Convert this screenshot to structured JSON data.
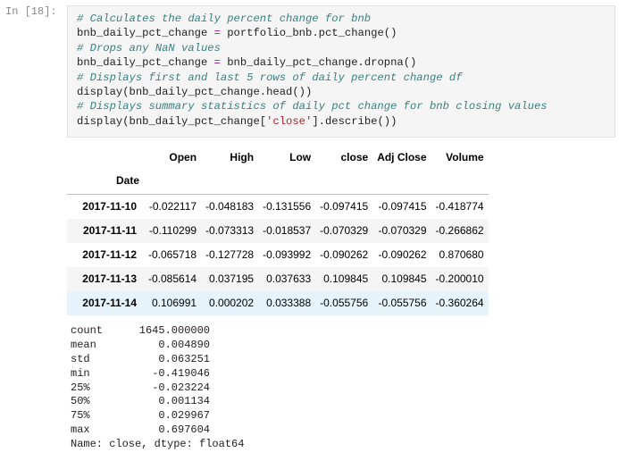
{
  "cell": {
    "prompt": "In [18]:",
    "code_lines": [
      [
        {
          "t": "# Calculates the daily percent change for bnb",
          "c": "cm"
        }
      ],
      [
        {
          "t": "bnb_daily_pct_change ",
          "c": "fn"
        },
        {
          "t": "=",
          "c": "op"
        },
        {
          "t": " portfolio_bnb.pct_change()",
          "c": "fn"
        }
      ],
      [
        {
          "t": "# Drops any NaN values",
          "c": "cm"
        }
      ],
      [
        {
          "t": "bnb_daily_pct_change ",
          "c": "fn"
        },
        {
          "t": "=",
          "c": "op"
        },
        {
          "t": " bnb_daily_pct_change.dropna()",
          "c": "fn"
        }
      ],
      [
        {
          "t": "# Displays first and last 5 rows of daily percent change df",
          "c": "cm"
        }
      ],
      [
        {
          "t": "display(bnb_daily_pct_change.head())",
          "c": "fn"
        }
      ],
      [
        {
          "t": "# Displays summary statistics of daily pct change for bnb closing values",
          "c": "cm"
        }
      ],
      [
        {
          "t": "display(bnb_daily_pct_change[",
          "c": "fn"
        },
        {
          "t": "'close'",
          "c": "str"
        },
        {
          "t": "].describe())",
          "c": "fn"
        }
      ]
    ]
  },
  "dataframe": {
    "columns": [
      "Open",
      "High",
      "Low",
      "close",
      "Adj Close",
      "Volume"
    ],
    "index_name": "Date",
    "rows": [
      {
        "index": "2017-11-10",
        "values": [
          "-0.022117",
          "-0.048183",
          "-0.131556",
          "-0.097415",
          "-0.097415",
          "-0.418774"
        ]
      },
      {
        "index": "2017-11-11",
        "values": [
          "-0.110299",
          "-0.073313",
          "-0.018537",
          "-0.070329",
          "-0.070329",
          "-0.266862"
        ]
      },
      {
        "index": "2017-11-12",
        "values": [
          "-0.065718",
          "-0.127728",
          "-0.093992",
          "-0.090262",
          "-0.090262",
          "0.870680"
        ]
      },
      {
        "index": "2017-11-13",
        "values": [
          "-0.085614",
          "0.037195",
          "0.037633",
          "0.109845",
          "0.109845",
          "-0.200010"
        ]
      },
      {
        "index": "2017-11-14",
        "values": [
          "0.106991",
          "0.000202",
          "0.033388",
          "-0.055756",
          "-0.055756",
          "-0.360264"
        ]
      }
    ],
    "hover_row_index": 4
  },
  "describe": {
    "rows": [
      {
        "label": "count",
        "value": "1645.000000"
      },
      {
        "label": "mean",
        "value": "0.004890"
      },
      {
        "label": "std",
        "value": "0.063251"
      },
      {
        "label": "min",
        "value": "-0.419046"
      },
      {
        "label": "25%",
        "value": "-0.023224"
      },
      {
        "label": "50%",
        "value": "0.001134"
      },
      {
        "label": "75%",
        "value": "0.029967"
      },
      {
        "label": "max",
        "value": "0.697604"
      }
    ],
    "footer": "Name: close, dtype: float64"
  },
  "colors": {
    "comment": "#3a7f7f",
    "operator": "#a01aa0",
    "string": "#b3202c",
    "hover_row": "#e6f3fb",
    "stripe_row": "#f5f5f5"
  }
}
